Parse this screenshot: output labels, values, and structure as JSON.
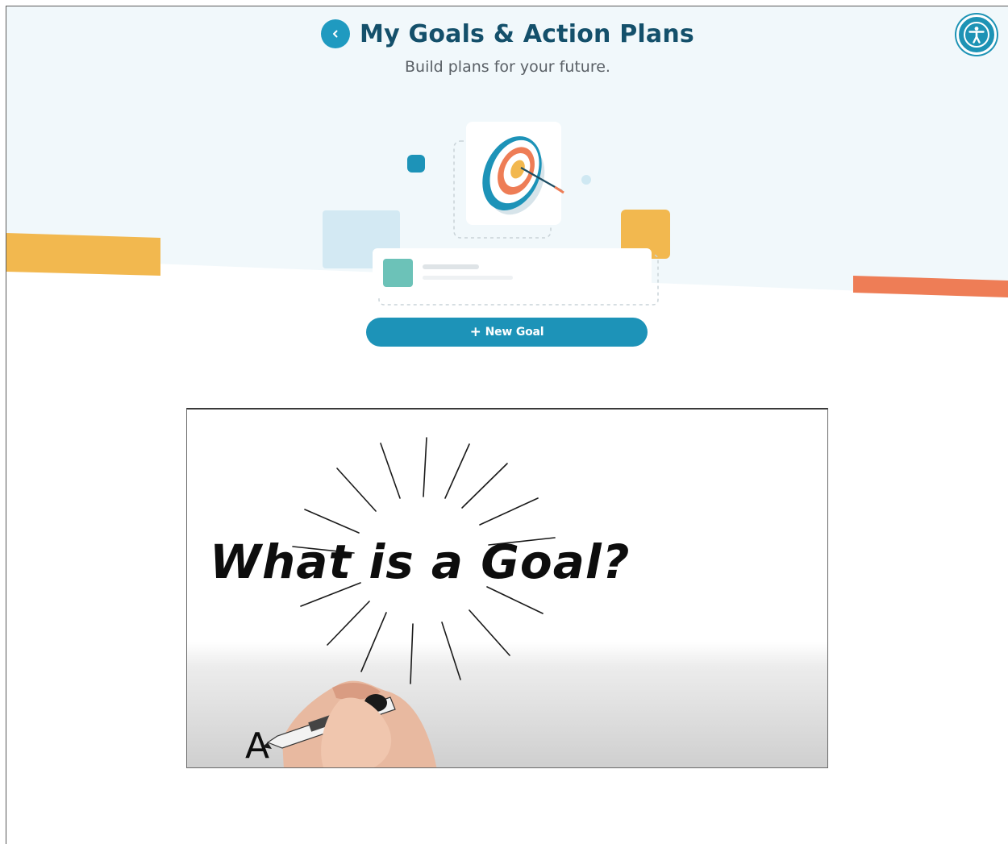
{
  "header": {
    "title": "My Goals & Action Plans",
    "subtitle": "Build plans for your future."
  },
  "icons": {
    "back": "chevron-left-icon",
    "accessibility": "accessibility-person-icon",
    "target": "target-arrow-icon",
    "plus": "plus-icon"
  },
  "actions": {
    "new_goal_plus": "+",
    "new_goal_label": "New Goal"
  },
  "video": {
    "title": "What is a Goal?",
    "caption_letter": "A"
  },
  "colors": {
    "primary": "#1d93b8",
    "title": "#14506b",
    "hero_bg": "#f1f8fb",
    "yellow": "#f2b84f",
    "orange": "#ee7d56",
    "teal_square": "#6cc2b8"
  }
}
